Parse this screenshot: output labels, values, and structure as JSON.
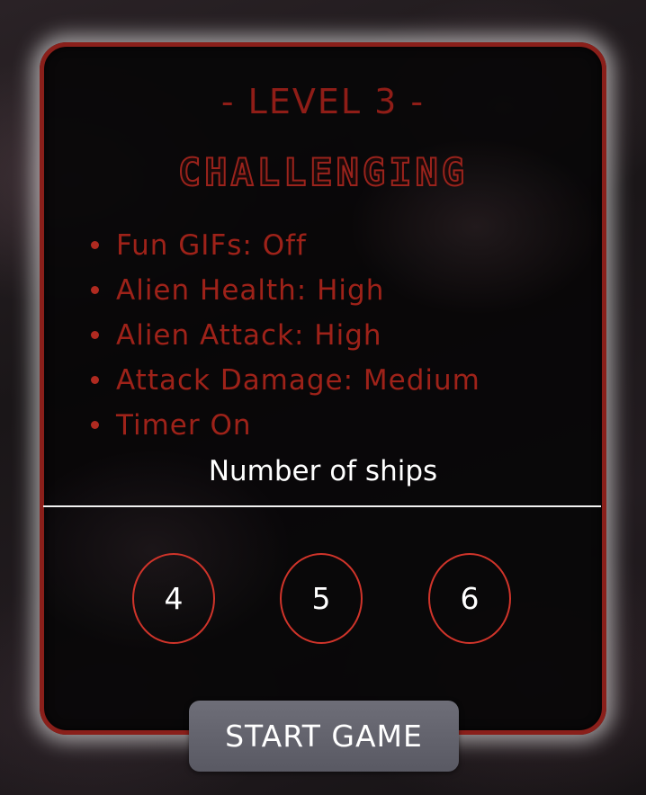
{
  "level_title": "- LEVEL 3 -",
  "difficulty": "CHALLENGING",
  "features": [
    "Fun GIFs: Off",
    "Alien Health: High",
    "Alien Attack: High",
    "Attack Damage: Medium",
    "Timer On"
  ],
  "ships": {
    "label": "Number of ships",
    "options": [
      "4",
      "5",
      "6"
    ]
  },
  "start_button": "START GAME",
  "colors": {
    "accent_red": "#9e2219",
    "border_red": "#8a1f1a",
    "option_ring": "#d0342a",
    "button_gray": "#62626c",
    "text_white": "#ffffff"
  }
}
